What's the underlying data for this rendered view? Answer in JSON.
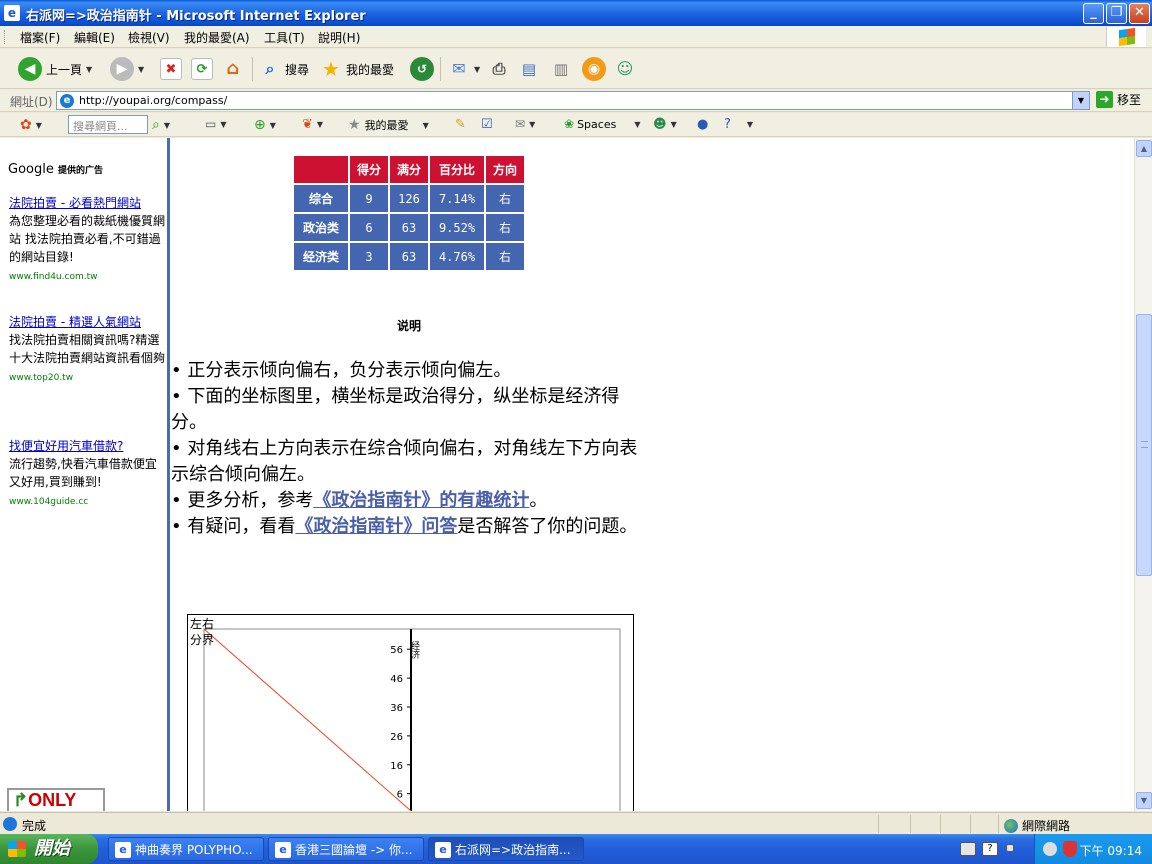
{
  "window": {
    "title": "右派网=>政治指南针 - Microsoft Internet Explorer"
  },
  "menu": [
    "檔案(F)",
    "編輯(E)",
    "檢視(V)",
    "我的最愛(A)",
    "工具(T)",
    "說明(H)"
  ],
  "toolbar": {
    "back": "上一頁",
    "search": "搜尋",
    "favorites": "我的最愛"
  },
  "address": {
    "label": "網址(D)",
    "url": "http://youpai.org/compass/",
    "go": "移至"
  },
  "searchbar": {
    "placeholder": "搜尋網頁...",
    "favorites": "我的最愛",
    "spaces": "Spaces"
  },
  "ads": {
    "header": "Google",
    "header_small": "提供的广告",
    "items": [
      {
        "title": "法院拍賣 - 必看熱門網站",
        "desc": "為您整理必看的裁紙機優質網站 找法院拍賣必看,不可錯過的網站目錄!",
        "url": "www.find4u.com.tw"
      },
      {
        "title": "法院拍賣 - 精選人氣網站",
        "desc": "找法院拍賣相關資訊嗎?精選十大法院拍賣網站資訊看個夠",
        "url": "www.top20.tw"
      },
      {
        "title": "找便宜好用汽車借款?",
        "desc": "流行趨勢,快看汽車借款便宜又好用,買到賺到!",
        "url": "www.104guide.cc"
      }
    ],
    "logo_text_1": "↱",
    "logo_text_2": "ONLY"
  },
  "score_table": {
    "headers": [
      "",
      "得分",
      "满分",
      "百分比",
      "方向"
    ],
    "rows": [
      [
        "综合",
        "9",
        "126",
        "7.14%",
        "右"
      ],
      [
        "政治类",
        "6",
        "63",
        "9.52%",
        "右"
      ],
      [
        "经济类",
        "3",
        "63",
        "4.76%",
        "右"
      ]
    ]
  },
  "explain": {
    "title": "说明",
    "lines": [
      "正分表示倾向偏右，负分表示倾向偏左。",
      "下面的坐标图里，横坐标是政治得分，纵坐标是经济得分。",
      "对角线右上方向表示在综合倾向偏右，对角线左下方向表示综合倾向偏左。"
    ],
    "line4_pre": "更多分析，参考",
    "line4_link": "《政治指南针》的有趣统计",
    "line4_post": "。",
    "line5_pre": "有疑问，看看",
    "line5_link": "《政治指南针》问答",
    "line5_post": "是否解答了你的问题。"
  },
  "chart_data": {
    "type": "line",
    "title": "",
    "corner_label_1": "左右",
    "corner_label_2": "分界",
    "y_axis_label": "经济",
    "y_ticks": [
      "56",
      "46",
      "36",
      "26",
      "16",
      "6"
    ],
    "y_tick_values": [
      56,
      46,
      36,
      26,
      16,
      6
    ],
    "series": [
      {
        "values": [
          [
            -63,
            63
          ],
          [
            0,
            0
          ]
        ]
      }
    ],
    "line_color": "#ee4422"
  },
  "status": {
    "text": "完成",
    "zone": "網際網路"
  },
  "taskbar": {
    "start": "開始",
    "tasks": [
      "神曲奏界 POLYPHO...",
      "香港三國論壇 -> 你...",
      "右派网=>政治指南..."
    ],
    "clock": "下午 09:14"
  }
}
